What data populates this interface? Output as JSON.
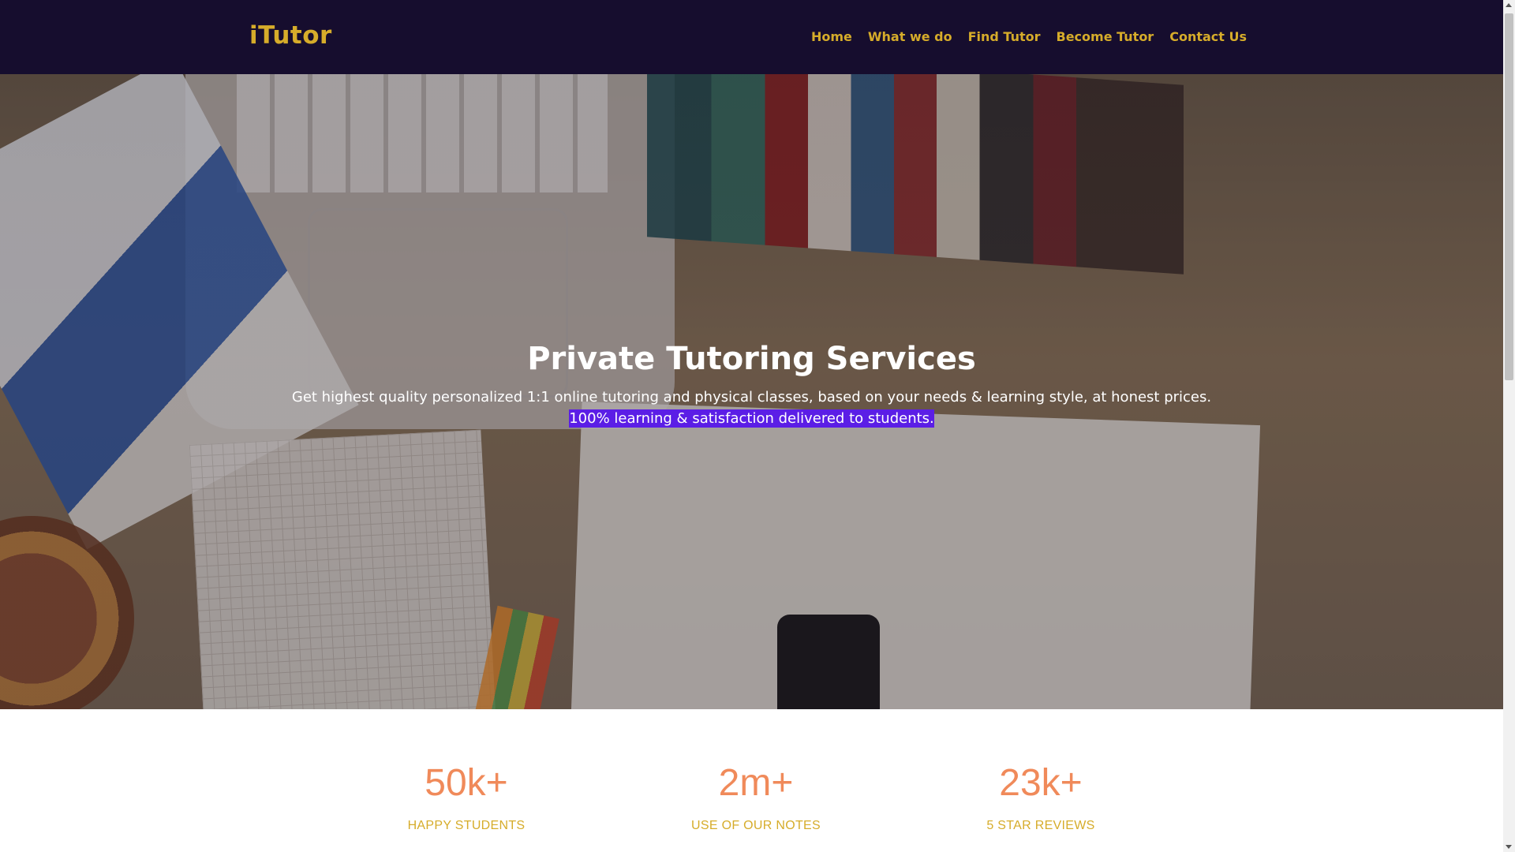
{
  "header": {
    "brand": "iTutor",
    "nav": [
      {
        "label": "Home"
      },
      {
        "label": "What we do"
      },
      {
        "label": "Find Tutor"
      },
      {
        "label": "Become Tutor"
      },
      {
        "label": "Contact Us"
      }
    ]
  },
  "hero": {
    "title": "Private Tutoring Services",
    "subtitle_line1": "Get highest quality personalized 1:1 online tutoring and physical classes, based on your needs & learning style, at honest prices.",
    "subtitle_line2": "100% learning & satisfaction delivered to students."
  },
  "stats": [
    {
      "value": "50k+",
      "label": "HAPPY STUDENTS"
    },
    {
      "value": "2m+",
      "label": "USE OF OUR NOTES"
    },
    {
      "value": "23k+",
      "label": "5 STAR REVIEWS"
    }
  ],
  "colors": {
    "nav_bg": "#160d2e",
    "brand": "#d6ac2a",
    "stat_value": "#f08a5a",
    "stat_label": "#d6ac2a",
    "selection": "#5b1ee6"
  }
}
